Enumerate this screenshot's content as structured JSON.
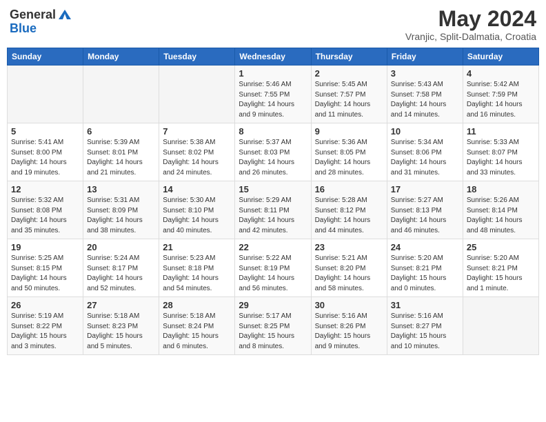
{
  "header": {
    "logo_general": "General",
    "logo_blue": "Blue",
    "month_title": "May 2024",
    "location": "Vranjic, Split-Dalmatia, Croatia"
  },
  "weekdays": [
    "Sunday",
    "Monday",
    "Tuesday",
    "Wednesday",
    "Thursday",
    "Friday",
    "Saturday"
  ],
  "weeks": [
    [
      {
        "day": "",
        "sunrise": "",
        "sunset": "",
        "daylight": ""
      },
      {
        "day": "",
        "sunrise": "",
        "sunset": "",
        "daylight": ""
      },
      {
        "day": "",
        "sunrise": "",
        "sunset": "",
        "daylight": ""
      },
      {
        "day": "1",
        "sunrise": "Sunrise: 5:46 AM",
        "sunset": "Sunset: 7:55 PM",
        "daylight": "Daylight: 14 hours and 9 minutes."
      },
      {
        "day": "2",
        "sunrise": "Sunrise: 5:45 AM",
        "sunset": "Sunset: 7:57 PM",
        "daylight": "Daylight: 14 hours and 11 minutes."
      },
      {
        "day": "3",
        "sunrise": "Sunrise: 5:43 AM",
        "sunset": "Sunset: 7:58 PM",
        "daylight": "Daylight: 14 hours and 14 minutes."
      },
      {
        "day": "4",
        "sunrise": "Sunrise: 5:42 AM",
        "sunset": "Sunset: 7:59 PM",
        "daylight": "Daylight: 14 hours and 16 minutes."
      }
    ],
    [
      {
        "day": "5",
        "sunrise": "Sunrise: 5:41 AM",
        "sunset": "Sunset: 8:00 PM",
        "daylight": "Daylight: 14 hours and 19 minutes."
      },
      {
        "day": "6",
        "sunrise": "Sunrise: 5:39 AM",
        "sunset": "Sunset: 8:01 PM",
        "daylight": "Daylight: 14 hours and 21 minutes."
      },
      {
        "day": "7",
        "sunrise": "Sunrise: 5:38 AM",
        "sunset": "Sunset: 8:02 PM",
        "daylight": "Daylight: 14 hours and 24 minutes."
      },
      {
        "day": "8",
        "sunrise": "Sunrise: 5:37 AM",
        "sunset": "Sunset: 8:03 PM",
        "daylight": "Daylight: 14 hours and 26 minutes."
      },
      {
        "day": "9",
        "sunrise": "Sunrise: 5:36 AM",
        "sunset": "Sunset: 8:05 PM",
        "daylight": "Daylight: 14 hours and 28 minutes."
      },
      {
        "day": "10",
        "sunrise": "Sunrise: 5:34 AM",
        "sunset": "Sunset: 8:06 PM",
        "daylight": "Daylight: 14 hours and 31 minutes."
      },
      {
        "day": "11",
        "sunrise": "Sunrise: 5:33 AM",
        "sunset": "Sunset: 8:07 PM",
        "daylight": "Daylight: 14 hours and 33 minutes."
      }
    ],
    [
      {
        "day": "12",
        "sunrise": "Sunrise: 5:32 AM",
        "sunset": "Sunset: 8:08 PM",
        "daylight": "Daylight: 14 hours and 35 minutes."
      },
      {
        "day": "13",
        "sunrise": "Sunrise: 5:31 AM",
        "sunset": "Sunset: 8:09 PM",
        "daylight": "Daylight: 14 hours and 38 minutes."
      },
      {
        "day": "14",
        "sunrise": "Sunrise: 5:30 AM",
        "sunset": "Sunset: 8:10 PM",
        "daylight": "Daylight: 14 hours and 40 minutes."
      },
      {
        "day": "15",
        "sunrise": "Sunrise: 5:29 AM",
        "sunset": "Sunset: 8:11 PM",
        "daylight": "Daylight: 14 hours and 42 minutes."
      },
      {
        "day": "16",
        "sunrise": "Sunrise: 5:28 AM",
        "sunset": "Sunset: 8:12 PM",
        "daylight": "Daylight: 14 hours and 44 minutes."
      },
      {
        "day": "17",
        "sunrise": "Sunrise: 5:27 AM",
        "sunset": "Sunset: 8:13 PM",
        "daylight": "Daylight: 14 hours and 46 minutes."
      },
      {
        "day": "18",
        "sunrise": "Sunrise: 5:26 AM",
        "sunset": "Sunset: 8:14 PM",
        "daylight": "Daylight: 14 hours and 48 minutes."
      }
    ],
    [
      {
        "day": "19",
        "sunrise": "Sunrise: 5:25 AM",
        "sunset": "Sunset: 8:15 PM",
        "daylight": "Daylight: 14 hours and 50 minutes."
      },
      {
        "day": "20",
        "sunrise": "Sunrise: 5:24 AM",
        "sunset": "Sunset: 8:17 PM",
        "daylight": "Daylight: 14 hours and 52 minutes."
      },
      {
        "day": "21",
        "sunrise": "Sunrise: 5:23 AM",
        "sunset": "Sunset: 8:18 PM",
        "daylight": "Daylight: 14 hours and 54 minutes."
      },
      {
        "day": "22",
        "sunrise": "Sunrise: 5:22 AM",
        "sunset": "Sunset: 8:19 PM",
        "daylight": "Daylight: 14 hours and 56 minutes."
      },
      {
        "day": "23",
        "sunrise": "Sunrise: 5:21 AM",
        "sunset": "Sunset: 8:20 PM",
        "daylight": "Daylight: 14 hours and 58 minutes."
      },
      {
        "day": "24",
        "sunrise": "Sunrise: 5:20 AM",
        "sunset": "Sunset: 8:21 PM",
        "daylight": "Daylight: 15 hours and 0 minutes."
      },
      {
        "day": "25",
        "sunrise": "Sunrise: 5:20 AM",
        "sunset": "Sunset: 8:21 PM",
        "daylight": "Daylight: 15 hours and 1 minute."
      }
    ],
    [
      {
        "day": "26",
        "sunrise": "Sunrise: 5:19 AM",
        "sunset": "Sunset: 8:22 PM",
        "daylight": "Daylight: 15 hours and 3 minutes."
      },
      {
        "day": "27",
        "sunrise": "Sunrise: 5:18 AM",
        "sunset": "Sunset: 8:23 PM",
        "daylight": "Daylight: 15 hours and 5 minutes."
      },
      {
        "day": "28",
        "sunrise": "Sunrise: 5:18 AM",
        "sunset": "Sunset: 8:24 PM",
        "daylight": "Daylight: 15 hours and 6 minutes."
      },
      {
        "day": "29",
        "sunrise": "Sunrise: 5:17 AM",
        "sunset": "Sunset: 8:25 PM",
        "daylight": "Daylight: 15 hours and 8 minutes."
      },
      {
        "day": "30",
        "sunrise": "Sunrise: 5:16 AM",
        "sunset": "Sunset: 8:26 PM",
        "daylight": "Daylight: 15 hours and 9 minutes."
      },
      {
        "day": "31",
        "sunrise": "Sunrise: 5:16 AM",
        "sunset": "Sunset: 8:27 PM",
        "daylight": "Daylight: 15 hours and 10 minutes."
      },
      {
        "day": "",
        "sunrise": "",
        "sunset": "",
        "daylight": ""
      }
    ]
  ]
}
